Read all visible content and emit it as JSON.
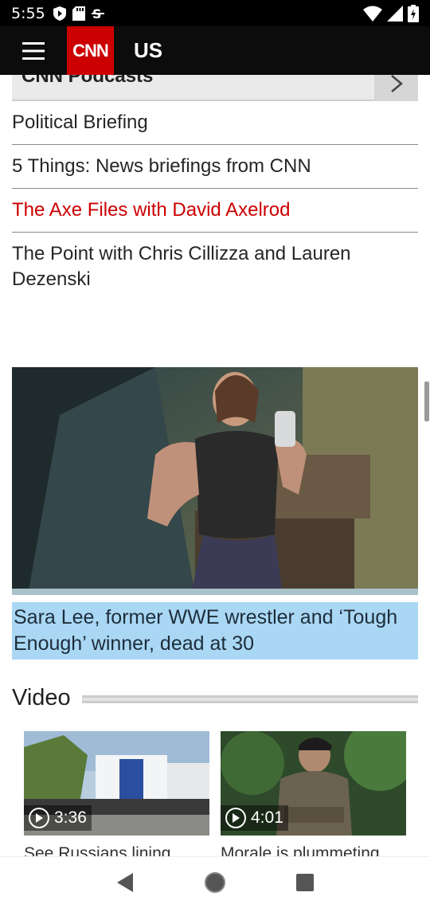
{
  "status_bar": {
    "time": "5:55"
  },
  "header": {
    "logo_text": "CNN",
    "section": "US"
  },
  "podcasts": {
    "title": "CNN Podcasts",
    "items": [
      {
        "label": "Political Briefing"
      },
      {
        "label": "5 Things: News briefings from CNN"
      },
      {
        "label": "The Axe Files with David Axelrod"
      },
      {
        "label": "The Point with Chris Cillizza and Lauren Dezenski"
      }
    ]
  },
  "story": {
    "headline": "Sara Lee, former WWE wrestler and ‘Tough Enough’ winner, dead at 30"
  },
  "video": {
    "title": "Video",
    "cards": [
      {
        "duration": "3:36",
        "caption": "See Russians lining"
      },
      {
        "duration": "4:01",
        "caption": "Morale is plummeting"
      }
    ]
  },
  "colors": {
    "cnn_red": "#cc0000",
    "highlight": "#a9d7f4",
    "header_bg": "#0c0c0c"
  }
}
